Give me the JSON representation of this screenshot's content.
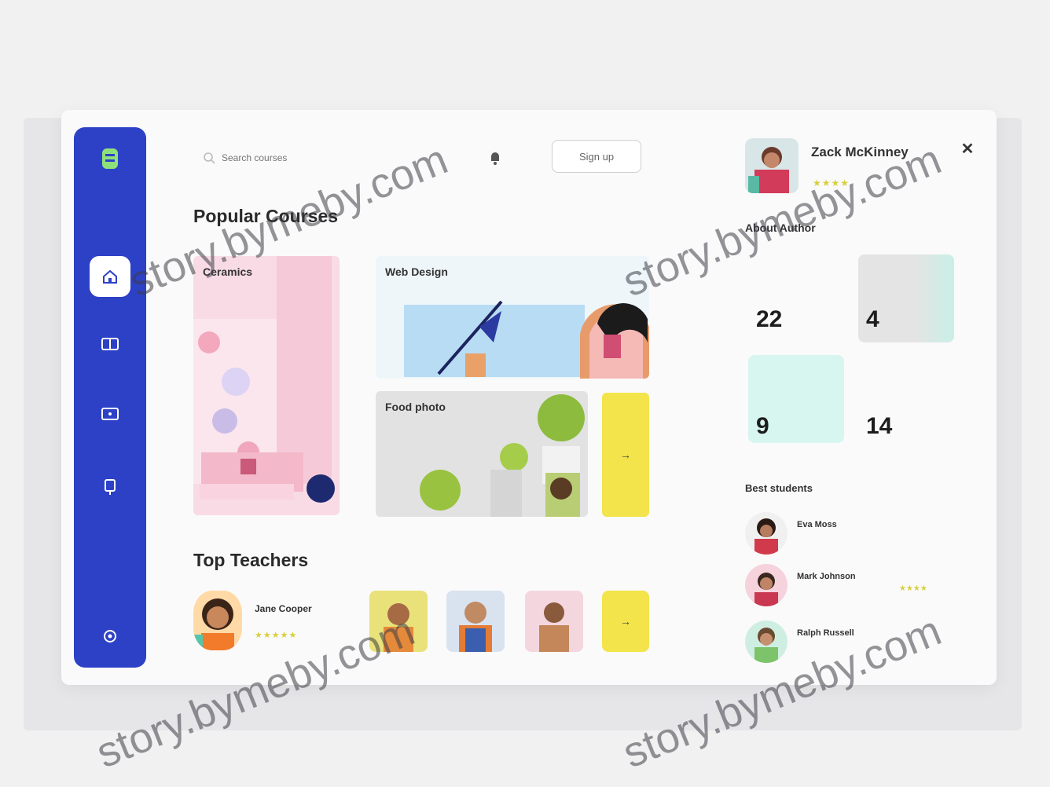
{
  "search": {
    "placeholder": "Search courses"
  },
  "header": {
    "signup_label": "Sign up"
  },
  "sections": {
    "popular": "Popular Courses",
    "teachers": "Top Teachers"
  },
  "courses": [
    {
      "title": "Ceramics",
      "subtitle": ""
    },
    {
      "title": "Web Design",
      "subtitle": ""
    },
    {
      "title": "Food photo",
      "subtitle": ""
    }
  ],
  "course_more_label": "→",
  "teacher": {
    "name": "Jane Cooper",
    "role": "",
    "stars": "★★★★★"
  },
  "teacher_more_label": "→",
  "profile": {
    "name": "Zack McKinney",
    "role": "",
    "stars": "★★★★",
    "close": "✕"
  },
  "about": {
    "heading": "About Author",
    "stats": [
      {
        "label": "",
        "value": "22"
      },
      {
        "label": "",
        "value": "4"
      },
      {
        "label": "",
        "value": "9"
      },
      {
        "label": "",
        "value": "14"
      }
    ]
  },
  "best_students": {
    "heading": "Best students",
    "rows": [
      {
        "name": "Eva Moss",
        "sub": "",
        "tag": "",
        "tag2": ""
      },
      {
        "name": "Mark Johnson",
        "sub": "",
        "tag": "",
        "tag2": "★★★★"
      },
      {
        "name": "Ralph Russell",
        "sub": "",
        "tag": "",
        "tag2": ""
      }
    ]
  },
  "watermark": "story.bymeby.com",
  "colors": {
    "sidebar": "#2d41c7",
    "accent_yellow": "#f2e44a",
    "mint": "#d7f6ef",
    "pink": "#f8dbe5"
  }
}
